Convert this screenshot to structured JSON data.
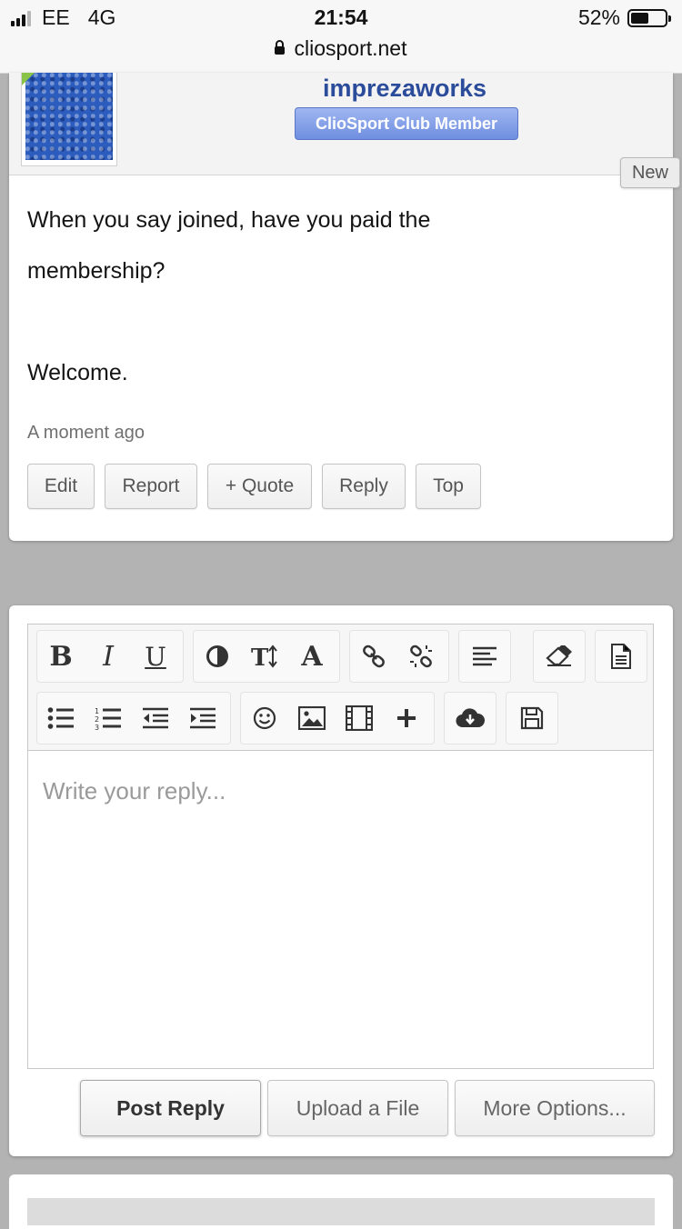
{
  "status_bar": {
    "carrier": "EE",
    "network": "4G",
    "time": "21:54",
    "battery_percent": "52%",
    "battery_level": 0.52,
    "url": "cliosport.net"
  },
  "post": {
    "username": "imprezaworks",
    "badge": "ClioSport Club Member",
    "new_tag": "New",
    "body_lines": [
      "When you say joined, have you paid the",
      "membership?",
      "Welcome."
    ],
    "timestamp": "A moment ago",
    "actions": {
      "edit": "Edit",
      "report": "Report",
      "quote": "+ Quote",
      "reply": "Reply",
      "top": "Top"
    }
  },
  "editor": {
    "placeholder": "Write your reply...",
    "toolbar_icons": [
      "bold-icon",
      "italic-icon",
      "underline-icon",
      "color-icon",
      "font-size-icon",
      "font-icon",
      "link-icon",
      "unlink-icon",
      "align-icon",
      "eraser-icon",
      "source-icon",
      "bullet-list-icon",
      "numbered-list-icon",
      "outdent-icon",
      "indent-icon",
      "smiley-icon",
      "image-icon",
      "media-icon",
      "insert-icon",
      "cloud-download-icon",
      "save-icon"
    ],
    "post_reply": "Post Reply",
    "upload_file": "Upload a File",
    "more_options": "More Options..."
  },
  "colors": {
    "username": "#2b4b9b",
    "badge": "#7f9be6",
    "page_bg": "#b3b3b3"
  }
}
